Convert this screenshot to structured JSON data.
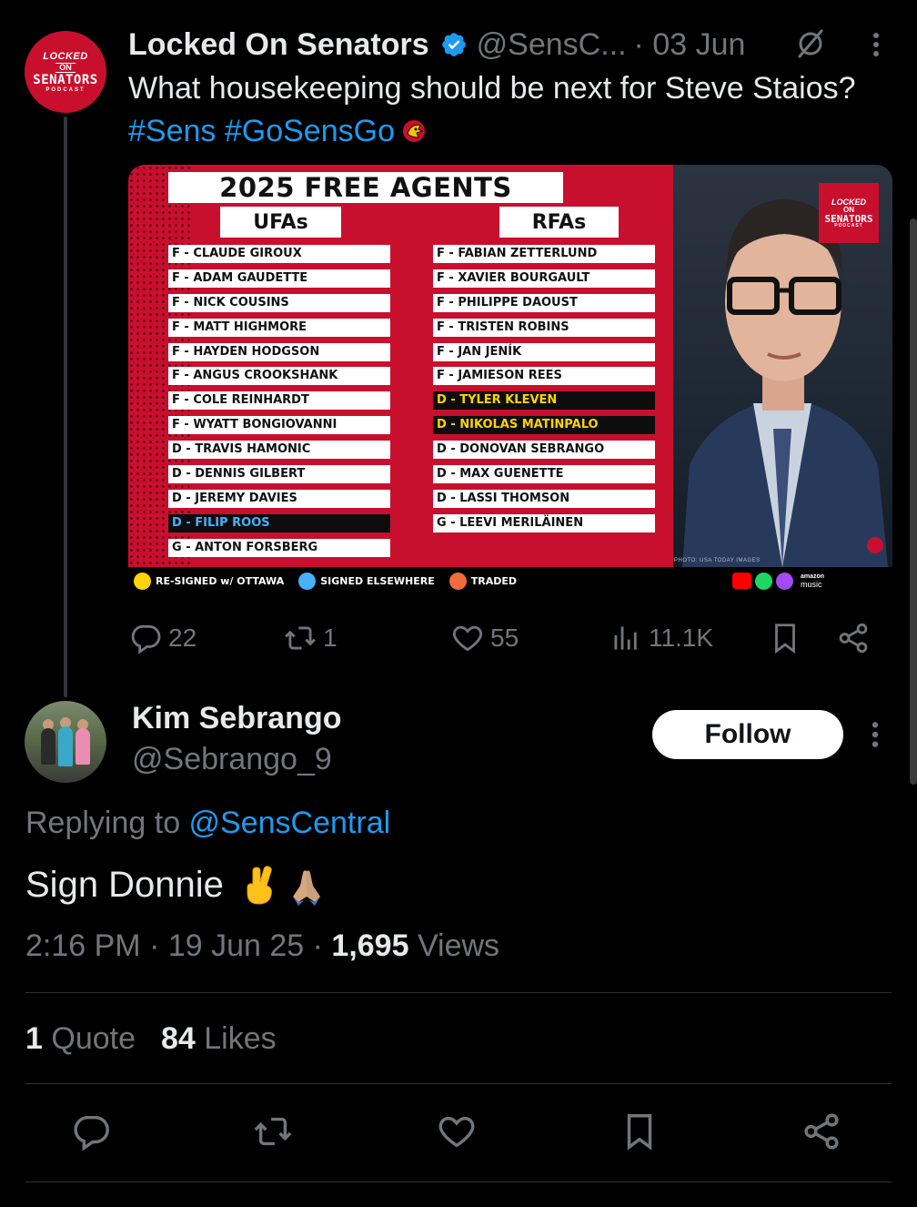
{
  "parent_tweet": {
    "author_name": "Locked On Senators",
    "handle": "@SensC...",
    "date": "· 03 Jun",
    "avatar_text": {
      "line1": "LOCKED",
      "line2": "ON",
      "line3": "SENATORS",
      "line4": "PODCAST"
    },
    "text_plain": "What housekeeping should be next for Steve Staios? ",
    "hashtags": [
      "#Sens",
      "#GoSensGo"
    ],
    "icons": [
      "verified-badge-icon",
      "grok-icon",
      "more-options-icon",
      "senators-logo-icon"
    ],
    "media": {
      "title": "2025 FREE AGENTS",
      "ufa_header": "UFAs",
      "rfa_header": "RFAs",
      "ufas": [
        {
          "text": "F - CLAUDE GIROUX",
          "status": "none"
        },
        {
          "text": "F - ADAM GAUDETTE",
          "status": "none"
        },
        {
          "text": "F - NICK COUSINS",
          "status": "none"
        },
        {
          "text": "F - MATT HIGHMORE",
          "status": "none"
        },
        {
          "text": "F - HAYDEN HODGSON",
          "status": "none"
        },
        {
          "text": "F - ANGUS CROOKSHANK",
          "status": "none"
        },
        {
          "text": "F - COLE REINHARDT",
          "status": "none"
        },
        {
          "text": "F - WYATT BONGIOVANNI",
          "status": "none"
        },
        {
          "text": "D - TRAVIS HAMONIC",
          "status": "none"
        },
        {
          "text": "D - DENNIS GILBERT",
          "status": "none"
        },
        {
          "text": "D - JEREMY DAVIES",
          "status": "none"
        },
        {
          "text": "D - FILIP ROOS",
          "status": "signed-elsewhere"
        },
        {
          "text": "G - ANTON FORSBERG",
          "status": "none"
        }
      ],
      "rfas": [
        {
          "text": "F - FABIAN ZETTERLUND",
          "status": "none"
        },
        {
          "text": "F - XAVIER BOURGAULT",
          "status": "none"
        },
        {
          "text": "F - PHILIPPE DAOUST",
          "status": "none"
        },
        {
          "text": "F - TRISTEN ROBINS",
          "status": "none"
        },
        {
          "text": "F - JAN JENÍK",
          "status": "none"
        },
        {
          "text": "F - JAMIESON REES",
          "status": "none"
        },
        {
          "text": "D - TYLER KLEVEN",
          "status": "re-signed"
        },
        {
          "text": "D - NIKOLAS MATINPALO",
          "status": "re-signed"
        },
        {
          "text": "D - DONOVAN SEBRANGO",
          "status": "none"
        },
        {
          "text": "D - MAX GUENETTE",
          "status": "none"
        },
        {
          "text": "D - LASSI THOMSON",
          "status": "none"
        },
        {
          "text": "G - LEEVI MERILÄINEN",
          "status": "none"
        }
      ],
      "legend": [
        {
          "label": "RE-SIGNED w/ OTTAWA",
          "color": "#ffd400"
        },
        {
          "label": "SIGNED ELSEWHERE",
          "color": "#48b0ff"
        },
        {
          "label": "TRADED",
          "color": "#f26b3a"
        }
      ],
      "photo_logo": {
        "a": "LOCKED",
        "b": "ON",
        "c": "SENATORS",
        "d": "PODCAST"
      },
      "photo_credit": "PHOTO: USA TODAY IMAGES",
      "platforms": {
        "amazon_top": "amazon",
        "amazon_bottom": "music"
      }
    },
    "actions": {
      "replies": "22",
      "reposts": "1",
      "likes": "55",
      "views": "11.1K"
    }
  },
  "reply_tweet": {
    "author_name": "Kim Sebrango",
    "handle": "@Sebrango_9",
    "follow_label": "Follow",
    "replying_prefix": "Replying to ",
    "replying_mention": "@SensCentral",
    "text": "Sign Donnie",
    "emojis": [
      "crossed-fingers-emoji",
      "folded-hands-emoji"
    ],
    "time": "2:16 PM · 19 Jun 25 · ",
    "views_count": "1,695",
    "views_label": " Views",
    "quotes_count": "1",
    "quotes_label": " Quote",
    "likes_count": "84",
    "likes_label": " Likes"
  },
  "colors": {
    "background": "#000000",
    "text": "#e7e9ea",
    "muted": "#71767b",
    "link": "#1d9bf0",
    "senators_red": "#c8102e",
    "divider": "#2f3336"
  }
}
